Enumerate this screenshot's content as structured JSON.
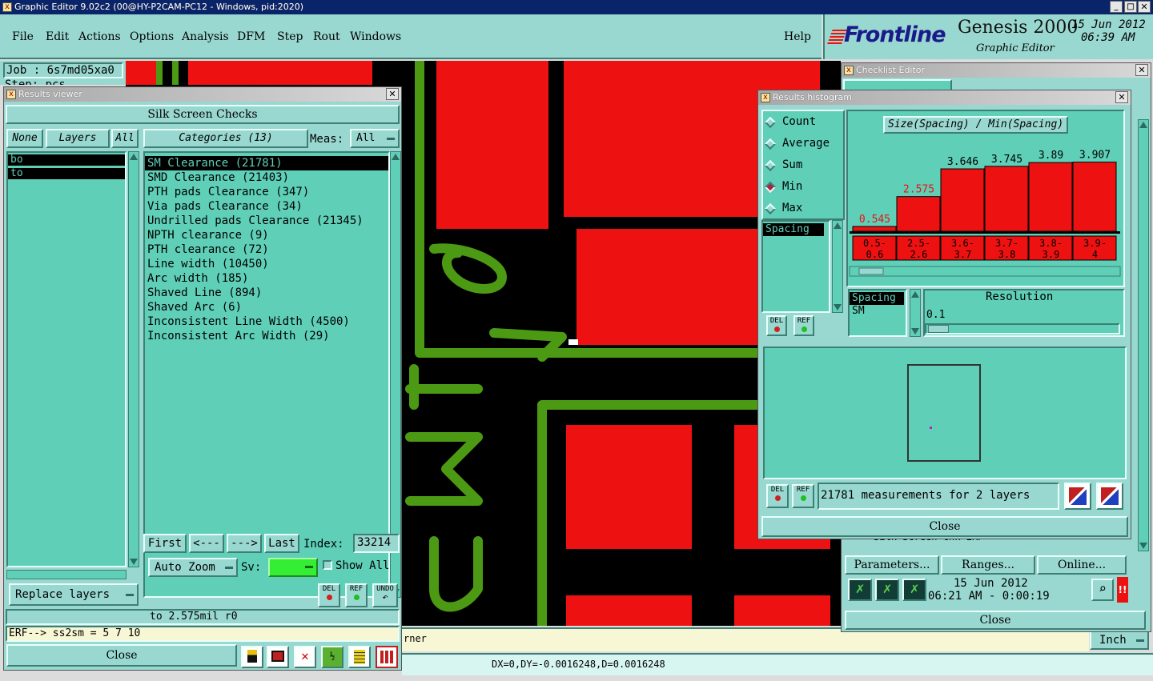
{
  "window": {
    "title": "Graphic Editor 9.02c2 (00@HY-P2CAM-PC12 - Windows, pid:2020)"
  },
  "menu": {
    "items": [
      "File",
      "Edit",
      "Actions",
      "Options",
      "Analysis",
      "DFM",
      "Step",
      "Rout",
      "Windows"
    ],
    "help": "Help"
  },
  "brand": {
    "logo": "Frontline",
    "product": "Genesis 2000",
    "subtitle": "Graphic Editor",
    "date": "15 Jun 2012",
    "time": "06:39 AM"
  },
  "job": {
    "label": "Job : 6s7md05xa0",
    "step_partial": "Step: pcs"
  },
  "results_viewer": {
    "title": "Results viewer",
    "heading": "Silk Screen Checks",
    "none_btn": "None",
    "layers_btn": "Layers",
    "all_btn": "All",
    "layers": [
      "bo",
      "to"
    ],
    "categories_btn": "Categories (13)",
    "meas_label": "Meas:",
    "meas_value": "All",
    "categories": [
      "SM Clearance (21781)",
      "SMD Clearance (21403)",
      "PTH pads Clearance (347)",
      "Via pads Clearance (34)",
      "Undrilled pads Clearance (21345)",
      "NPTH clearance (9)",
      "PTH clearance (72)",
      "Line width (10450)",
      "Arc width (185)",
      "Shaved Line (894)",
      "Shaved Arc (6)",
      "Inconsistent Line Width (4500)",
      "Inconsistent Arc Width (29)"
    ],
    "first": "First",
    "prev": "<---",
    "next": "--->",
    "last": "Last",
    "index_label": "Index:",
    "index_value": "33214",
    "auto_zoom": "Auto Zoom",
    "sv_label": "Sv:",
    "show_all": "Show All",
    "replace_layers": "Replace layers",
    "del": "DEL",
    "ref": "REF",
    "undo": "UNDO",
    "status": "to 2.575mil  r0",
    "close": "Close"
  },
  "erf_line": "ERF--> ss2sm = 5 7 10",
  "bottom": {
    "corner_text": "rner",
    "coords": "DX=0,DY=-0.0016248,D=0.0016248",
    "units": "Inch"
  },
  "checklist_editor": {
    "title": "Checklist Editor",
    "partial_row": "Silk Screen Chk ERF",
    "parameters": "Parameters...",
    "ranges": "Ranges...",
    "online": "Online...",
    "date": "15 Jun 2012",
    "time": "06:21 AM - 0:00:19",
    "close": "Close"
  },
  "histogram": {
    "title": "Results histogram",
    "modes": [
      "Count",
      "Average",
      "Sum",
      "Min",
      "Max"
    ],
    "selected_mode": "Min",
    "param_list": [
      "Spacing"
    ],
    "chart_title": "Size(Spacing) / Min(Spacing)",
    "measurements": "21781 measurements for 2 layers",
    "resolution_label": "Resolution",
    "resolution_value": "0.1",
    "subsel": [
      "Spacing",
      "SM"
    ],
    "close": "Close"
  },
  "chart_data": {
    "type": "bar",
    "title": "Size(Spacing) / Min(Spacing)",
    "categories": [
      "0.5-0.6",
      "2.5-2.6",
      "3.6-3.7",
      "3.7-3.8",
      "3.8-3.9",
      "3.9-4"
    ],
    "values": [
      0.545,
      2.575,
      3.646,
      3.745,
      3.89,
      3.907
    ],
    "value_labels": [
      "0.545",
      "2.575",
      "3.646",
      "3.745",
      "3.89",
      "3.907"
    ],
    "ylim": [
      0,
      4.5
    ],
    "colors": {
      "bar": "#ee1111",
      "label_red": "#ee1111",
      "label_dark": "#000000"
    }
  },
  "colors": {
    "teal_bg": "#99d8d0",
    "panel": "#5fcfb7",
    "pcb_red": "#ee1111",
    "silk_green": "#4c9a14"
  }
}
